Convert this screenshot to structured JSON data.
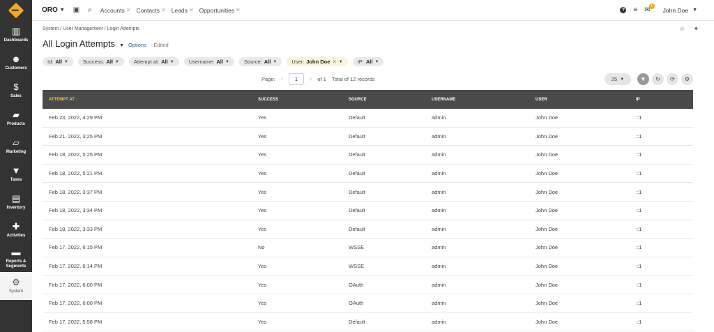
{
  "sidebar": {
    "items": [
      {
        "name": "dashboards",
        "label": "Dashboards",
        "icon": "bar-chart-icon",
        "glyph": "▥"
      },
      {
        "name": "customers",
        "label": "Customers",
        "icon": "users-icon",
        "glyph": "☻"
      },
      {
        "name": "sales",
        "label": "Sales",
        "icon": "dollar-icon",
        "glyph": "$"
      },
      {
        "name": "products",
        "label": "Products",
        "icon": "briefcase-icon",
        "glyph": "▰"
      },
      {
        "name": "marketing",
        "label": "Marketing",
        "icon": "book-icon",
        "glyph": "▱"
      },
      {
        "name": "taxes",
        "label": "Taxes",
        "icon": "funnel-icon",
        "glyph": "▼"
      },
      {
        "name": "inventory",
        "label": "Inventory",
        "icon": "document-icon",
        "glyph": "▤"
      },
      {
        "name": "activities",
        "label": "Activities",
        "icon": "puzzle-icon",
        "glyph": "✚"
      },
      {
        "name": "reports",
        "label": "Reports & Segments",
        "icon": "folder-icon",
        "glyph": "▬"
      },
      {
        "name": "system",
        "label": "System",
        "icon": "gear-icon",
        "glyph": "⚙"
      }
    ]
  },
  "header": {
    "brand": "ORO",
    "tabs": [
      "Accounts",
      "Contacts",
      "Leads",
      "Opportunities"
    ],
    "user_name": "John Doe",
    "notification_count": "1"
  },
  "page": {
    "breadcrumb": "System / User Management / Login Attempts",
    "title": "All Login Attempts",
    "options_label": "Options",
    "edited_label": "- Edited"
  },
  "filters": [
    {
      "name": "id",
      "label": "Id:",
      "value": "All"
    },
    {
      "name": "success",
      "label": "Success:",
      "value": "All"
    },
    {
      "name": "attempt-at",
      "label": "Attempt at:",
      "value": "All"
    },
    {
      "name": "username",
      "label": "Username:",
      "value": "All"
    },
    {
      "name": "source",
      "label": "Source:",
      "value": "All"
    },
    {
      "name": "user",
      "label": "User:",
      "value": "John Doe",
      "removable": true
    },
    {
      "name": "ip",
      "label": "IP:",
      "value": "All"
    }
  ],
  "pager": {
    "label": "Page:",
    "current": "1",
    "of_label": "of 1",
    "total_label": "Total of 12 records",
    "per_page": "25"
  },
  "table": {
    "columns": [
      "Attempt At",
      "Success",
      "Source",
      "Username",
      "User",
      "IP"
    ],
    "sorted_column": 0,
    "rows": [
      [
        "Feb 23, 2022, 4:29 PM",
        "Yes",
        "Default",
        "admin",
        "John Doe",
        "::1"
      ],
      [
        "Feb 21, 2022, 3:25 PM",
        "Yes",
        "Default",
        "admin",
        "John Doe",
        "::1"
      ],
      [
        "Feb 18, 2022, 5:25 PM",
        "Yes",
        "Default",
        "admin",
        "John Doe",
        "::1"
      ],
      [
        "Feb 18, 2022, 5:21 PM",
        "Yes",
        "Default",
        "admin",
        "John Doe",
        "::1"
      ],
      [
        "Feb 18, 2022, 3:37 PM",
        "Yes",
        "Default",
        "admin",
        "John Doe",
        "::1"
      ],
      [
        "Feb 18, 2022, 3:34 PM",
        "Yes",
        "Default",
        "admin",
        "John Doe",
        "::1"
      ],
      [
        "Feb 18, 2022, 3:33 PM",
        "Yes",
        "Default",
        "admin",
        "John Doe",
        "::1"
      ],
      [
        "Feb 17, 2022, 6:15 PM",
        "No",
        "WSSE",
        "admin",
        "John Doe",
        "::1"
      ],
      [
        "Feb 17, 2022, 6:14 PM",
        "Yes",
        "WSSE",
        "admin",
        "John Doe",
        "::1"
      ],
      [
        "Feb 17, 2022, 6:00 PM",
        "Yes",
        "OAuth",
        "admin",
        "John Doe",
        "::1"
      ],
      [
        "Feb 17, 2022, 6:00 PM",
        "Yes",
        "OAuth",
        "admin",
        "John Doe",
        "::1"
      ],
      [
        "Feb 17, 2022, 5:58 PM",
        "Yes",
        "Default",
        "admin",
        "John Doe",
        "::1"
      ]
    ]
  },
  "colors": {
    "accent": "#f5a623",
    "sidebar": "#333333",
    "table_header": "#4a4a4a",
    "sorted_header": "#f5c342"
  }
}
